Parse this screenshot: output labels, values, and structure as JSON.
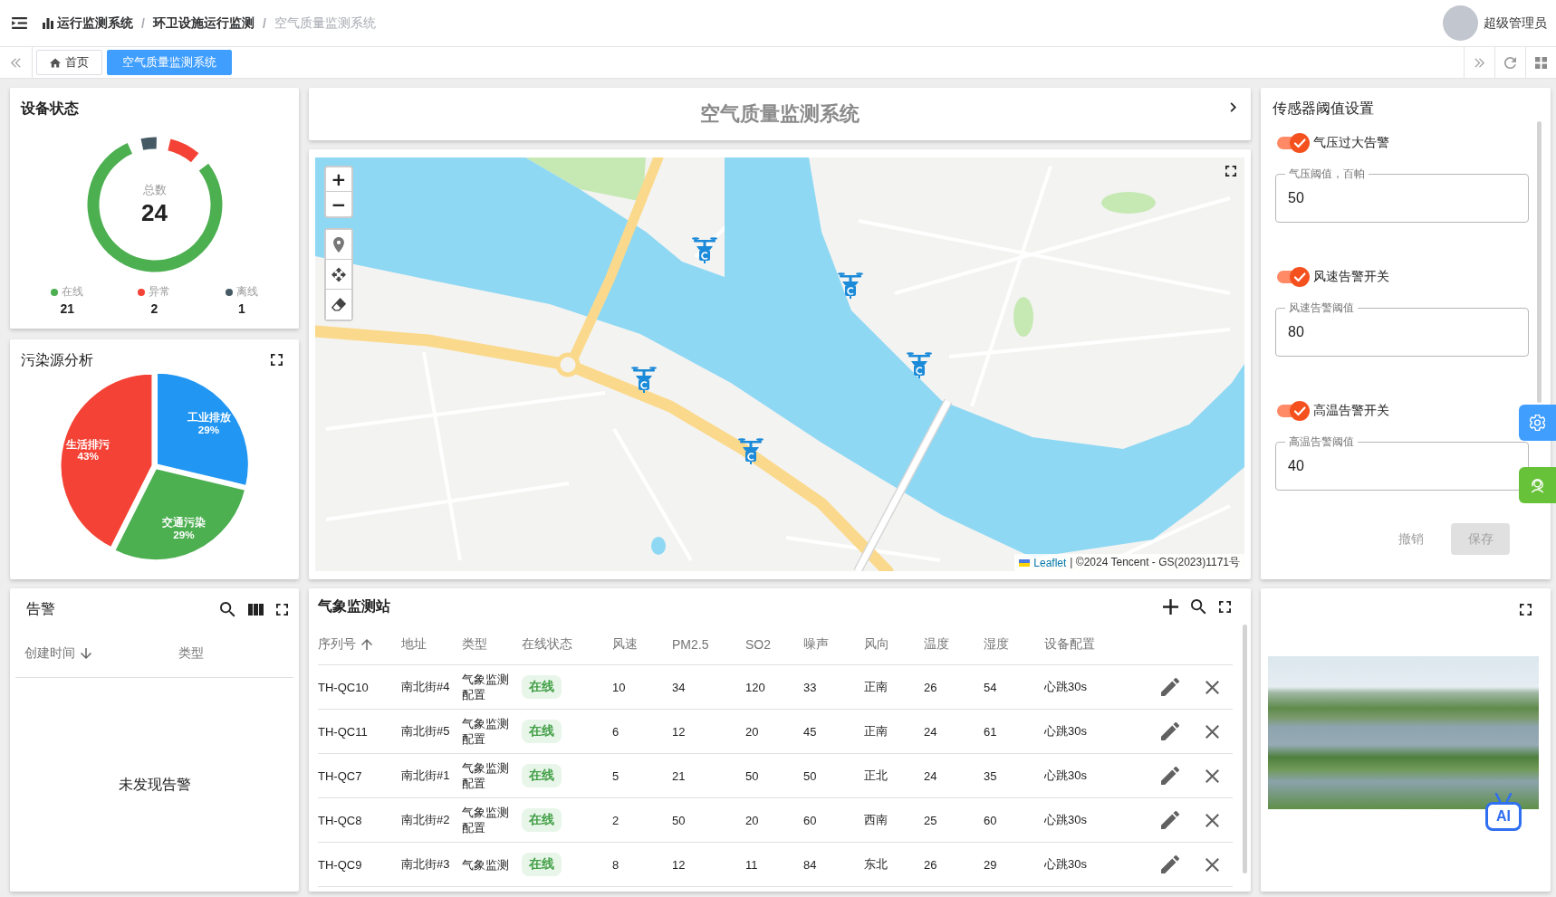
{
  "topbar": {
    "breadcrumbs": [
      {
        "label": "运行监测系统",
        "current": false
      },
      {
        "separator": "/",
        "label": "环卫设施运行监测",
        "current": false
      },
      {
        "separator": "/",
        "label": "空气质量监测系统",
        "current": true
      }
    ],
    "user": {
      "name": "超级管理员"
    }
  },
  "tabs": [
    {
      "label": "首页",
      "kind": "home",
      "selected": false
    },
    {
      "label": "空气质量监测系统",
      "kind": "page",
      "selected": true
    }
  ],
  "device_status": {
    "title": "设备状态",
    "total_label": "总数",
    "total": "24",
    "chart_data": {
      "type": "donut",
      "categories": [
        "在线",
        "异常",
        "离线"
      ],
      "values": [
        21,
        2,
        1
      ],
      "value_labels": [
        "21",
        "2",
        "1"
      ],
      "colors": [
        "#4caf50",
        "#f44336",
        "#455a64"
      ],
      "legend": "bottom"
    }
  },
  "pollution": {
    "title": "污染源分析",
    "chart_data": {
      "type": "pie",
      "categories": [
        "工业排放",
        "交通污染",
        "生活排污"
      ],
      "values": [
        29,
        29,
        43
      ],
      "value_labels": [
        "29%",
        "29%",
        "43%"
      ],
      "colors": [
        "#2196f3",
        "#4caf50",
        "#f44336"
      ]
    }
  },
  "title_card": {
    "title": "空气质量监测系统"
  },
  "map": {
    "zoom_in": "+",
    "zoom_out": "−",
    "attribution": {
      "link": "Leaflet",
      "text": "| ©2024 Tencent - GS(2023)1171号"
    }
  },
  "sensor_settings": {
    "title": "传感器阈值设置",
    "items": [
      {
        "label": "气压过大告警",
        "enabled": true,
        "field_label": "气压阈值，百帕",
        "value": "50"
      },
      {
        "label": "风速告警开关",
        "enabled": true,
        "field_label": "风速告警阈值",
        "value": "80"
      },
      {
        "label": "高温告警开关",
        "enabled": true,
        "field_label": "高温告警阈值",
        "value": "40"
      }
    ],
    "buttons": [
      {
        "label": "撤销",
        "kind": "text",
        "disabled": true
      },
      {
        "label": "保存",
        "kind": "contained",
        "disabled": true
      }
    ]
  },
  "alerts": {
    "title": "告警",
    "columns": [
      {
        "label": "创建时间",
        "sorted": true,
        "descending": true
      },
      {
        "label": "类型",
        "sorted": false
      }
    ],
    "empty_text": "未发现告警"
  },
  "stations": {
    "title": "气象监测站",
    "columns": [
      {
        "label": "序列号",
        "sorted": true,
        "descending": false
      },
      {
        "label": "地址",
        "sorted": false
      },
      {
        "label": "类型",
        "sorted": false
      },
      {
        "label": "在线状态",
        "sorted": false
      },
      {
        "label": "风速",
        "sorted": false
      },
      {
        "label": "PM2.5",
        "sorted": false
      },
      {
        "label": "SO2",
        "sorted": false
      },
      {
        "label": "噪声",
        "sorted": false
      },
      {
        "label": "风向",
        "sorted": false
      },
      {
        "label": "温度",
        "sorted": false
      },
      {
        "label": "湿度",
        "sorted": false
      },
      {
        "label": "设备配置",
        "sorted": false
      }
    ],
    "rows": [
      {
        "serial": "TH-QC10",
        "address": "南北街#4",
        "type": "气象监测配置",
        "status": {
          "label": "在线",
          "kind": "online"
        },
        "wind_speed": "10",
        "pm25": "34",
        "so2": "120",
        "noise": "33",
        "wind_dir": "正南",
        "temp": "26",
        "humidity": "54",
        "config": "心跳30s"
      },
      {
        "serial": "TH-QC11",
        "address": "南北街#5",
        "type": "气象监测配置",
        "status": {
          "label": "在线",
          "kind": "online"
        },
        "wind_speed": "6",
        "pm25": "12",
        "so2": "20",
        "noise": "45",
        "wind_dir": "正南",
        "temp": "24",
        "humidity": "61",
        "config": "心跳30s"
      },
      {
        "serial": "TH-QC7",
        "address": "南北街#1",
        "type": "气象监测配置",
        "status": {
          "label": "在线",
          "kind": "online"
        },
        "wind_speed": "5",
        "pm25": "21",
        "so2": "50",
        "noise": "50",
        "wind_dir": "正北",
        "temp": "24",
        "humidity": "35",
        "config": "心跳30s"
      },
      {
        "serial": "TH-QC8",
        "address": "南北街#2",
        "type": "气象监测配置",
        "status": {
          "label": "在线",
          "kind": "online"
        },
        "wind_speed": "2",
        "pm25": "50",
        "so2": "20",
        "noise": "60",
        "wind_dir": "西南",
        "temp": "25",
        "humidity": "60",
        "config": "心跳30s"
      },
      {
        "serial": "TH-QC9",
        "address": "南北街#3",
        "type": "气象监测",
        "status": {
          "label": "在线",
          "kind": "online"
        },
        "wind_speed": "8",
        "pm25": "12",
        "so2": "11",
        "noise": "84",
        "wind_dir": "东北",
        "temp": "26",
        "humidity": "29",
        "config": "心跳30s"
      }
    ]
  },
  "media": {
    "ai_label": "AI"
  }
}
